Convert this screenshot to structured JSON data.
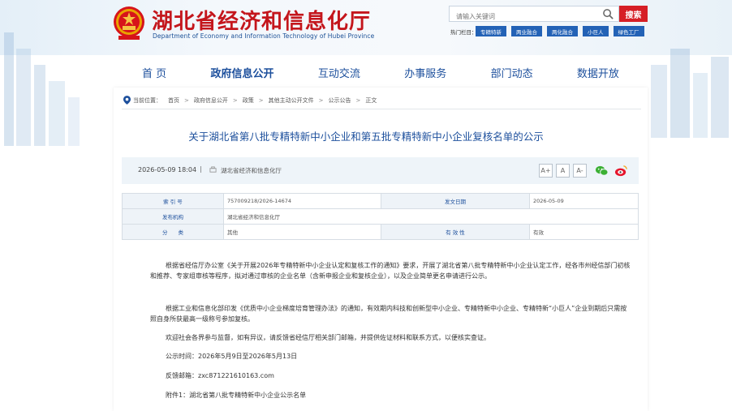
{
  "header": {
    "site_title": "湖北省经济和信息化厅",
    "site_subtitle": "Department of Economy and Information Technology of Hubei Province",
    "search_placeholder": "请输入关键词",
    "search_button": "搜索",
    "hot_label": "热门栏目：",
    "hot_tags": [
      "专精特新",
      "两业融合",
      "两化融合",
      "小巨人",
      "绿色工厂"
    ]
  },
  "nav": {
    "items": [
      "首 页",
      "政府信息公开",
      "互动交流",
      "办事服务",
      "部门动态",
      "数据开放"
    ],
    "active_index": 1
  },
  "breadcrumb": {
    "prefix": "当前位置：",
    "items": [
      "首页",
      "政府信息公开",
      "政策",
      "其他主动公开文件",
      "公示公告",
      "正文"
    ]
  },
  "article": {
    "title": "关于湖北省第八批专精特新中小企业和第五批专精特新中小企业复核名单的公示",
    "date": "2026-05-09 18:04",
    "source": "湖北省经济和信息化厅",
    "font_sizes": [
      "A+",
      "A",
      "A-"
    ],
    "info": {
      "index_label": "索 引 号",
      "index_value": "757009218/2026-14674",
      "issue_date_label": "发文日期",
      "issue_date_value": "2026-05-09",
      "publisher_label": "发布机构",
      "publisher_value": "湖北省经济和信息化厅",
      "category_label": "分　　类",
      "category_value": "其他",
      "validity_label": "有 效 性",
      "validity_value": "有效"
    },
    "paragraphs": [
      "根据省经信厅办公室《关于开展2026年专精特新中小企业认定和复核工作的通知》要求，开展了湖北省第八批专精特新中小企业认定工作，经各市州经信部门初核和推荐、专家组审核等程序，拟对通过审核的企业名单（含新申报企业和复核企业），以及企业简单更名申请进行公示。",
      "根据工业和信息化部印发《优质中小企业梯度培育管理办法》的通知，有效期内科技和创新型中小企业、专精特新中小企业、专精特新“小巨人”企业到期后只需按照自身所获最高一级称号参加复核。",
      "欢迎社会各界参与监督，如有异议，请反馈省经信厅相关部门邮箱，并提供佐证材料和联系方式，以便核实查证。",
      "公示时间：2026年5月9日至2026年5月13日",
      "反馈邮箱：zxc871221610163.com",
      "附件1：湖北省第八批专精特新中小企业公示名单"
    ]
  },
  "colors": {
    "brand_red": "#c4161c",
    "nav_blue": "#1c4f9c",
    "tag_blue": "#2362b6"
  }
}
